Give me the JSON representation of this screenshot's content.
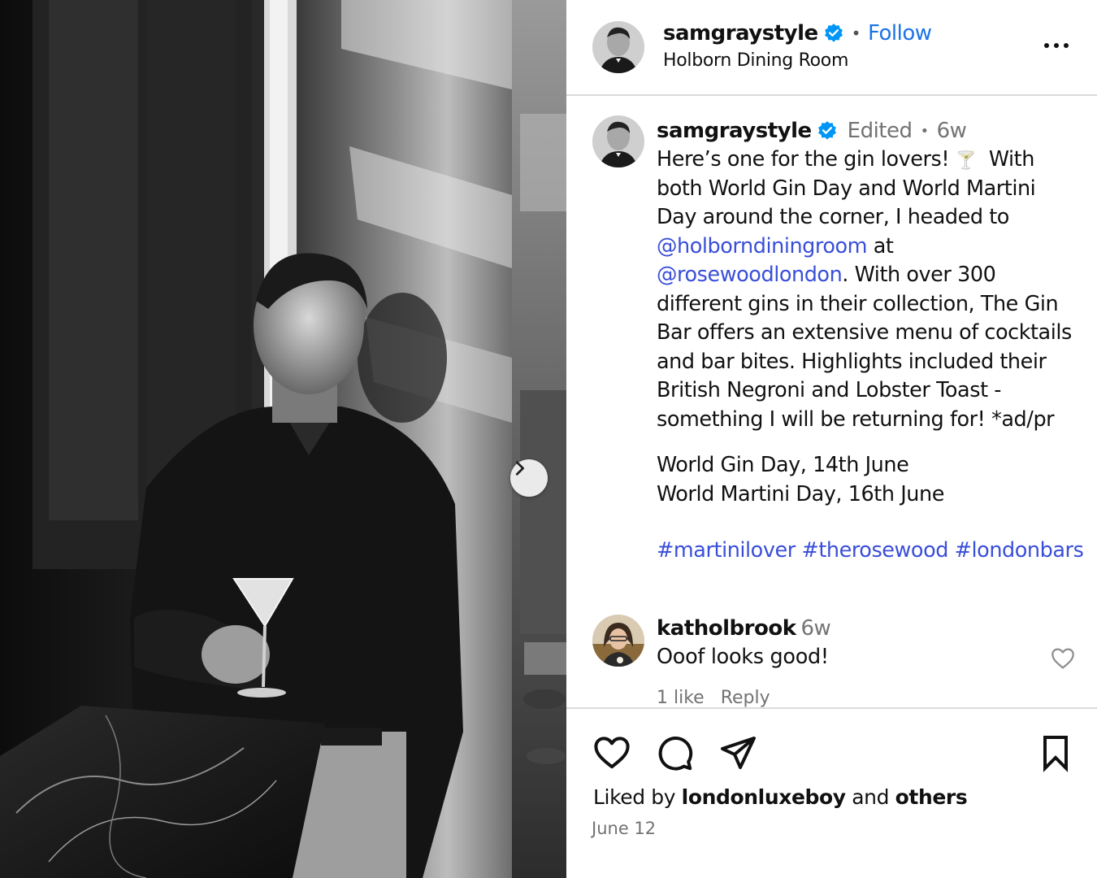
{
  "post": {
    "photo_alt": "Black and white photo of a man holding a martini glass by a window",
    "next_icon": "chevron-right-icon"
  },
  "header": {
    "username": "samgraystyle",
    "separator": "•",
    "follow_label": "Follow",
    "location": "Holborn Dining Room",
    "more_icon": "more-horizontal-icon"
  },
  "caption": {
    "username": "samgraystyle",
    "edited": "Edited",
    "separator": "•",
    "age": "6w",
    "lines": [
      "Here’s one for the gin lovers! ",
      "both World Gin Day and World Martini",
      "Day around the corner, I headed to",
      "@holborndiningroom",
      " at",
      "@rosewoodlondon",
      ". With over 300",
      "different gins in their collection, The Gin",
      "Bar offers an extensive menu of cocktails",
      "and bar bites. Highlights included their",
      "British Negroni and Lobster Toast -",
      "something I will be returning for! *ad/pr"
    ],
    "emoji": "🍸",
    "after_emoji": "  With",
    "dates": [
      "World Gin Day, 14th June",
      "World Martini Day, 16th June"
    ],
    "hashtags": [
      "#martinilover",
      "#therosewood",
      "#londonbars"
    ]
  },
  "comment": {
    "username": "katholbrook",
    "age": "6w",
    "text": "Ooof looks good!",
    "likes": "1 like",
    "reply_label": "Reply"
  },
  "actions": {
    "liked_prefix": "Liked by ",
    "liked_user": "londonluxeboy",
    "liked_mid": " and ",
    "liked_others": "others",
    "date": "June 12"
  },
  "colors": {
    "link": "#3a4fd8",
    "follow": "#1a73e8",
    "verified": "#0095f6",
    "muted": "#737373",
    "divider": "#dbdbdb"
  }
}
